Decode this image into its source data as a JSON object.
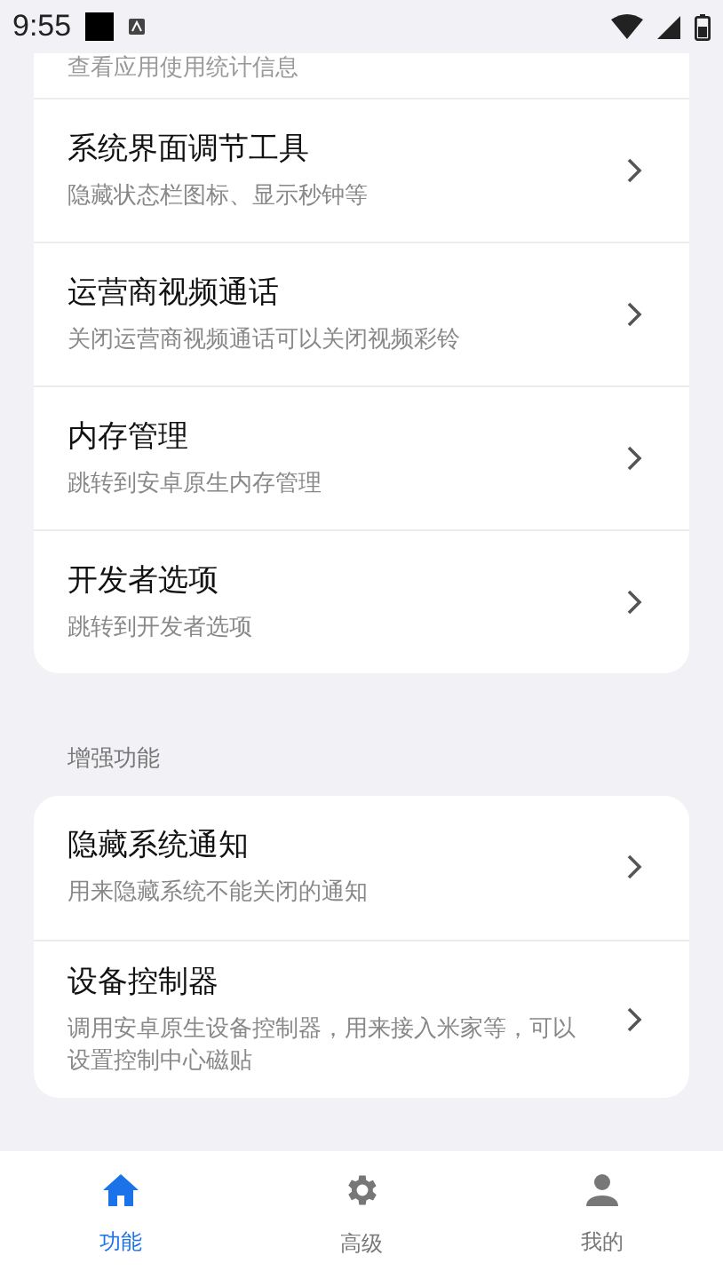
{
  "status_bar": {
    "time": "9:55"
  },
  "top_card": {
    "partial_subtitle": "查看应用使用统计信息",
    "items": [
      {
        "title": "系统界面调节工具",
        "subtitle": "隐藏状态栏图标、显示秒钟等"
      },
      {
        "title": "运营商视频通话",
        "subtitle": "关闭运营商视频通话可以关闭视频彩铃"
      },
      {
        "title": "内存管理",
        "subtitle": "跳转到安卓原生内存管理"
      },
      {
        "title": "开发者选项",
        "subtitle": "跳转到开发者选项"
      }
    ]
  },
  "section": {
    "label": "增强功能",
    "items": [
      {
        "title": "隐藏系统通知",
        "subtitle": "用来隐藏系统不能关闭的通知"
      },
      {
        "title": "设备控制器",
        "subtitle": "调用安卓原生设备控制器，用来接入米家等，可以设置控制中心磁贴"
      }
    ]
  },
  "bottom_nav": [
    {
      "kind": "home",
      "label": "功能",
      "selected": true
    },
    {
      "kind": "gear",
      "label": "高级",
      "selected": false
    },
    {
      "kind": "person",
      "label": "我的",
      "selected": false
    }
  ]
}
